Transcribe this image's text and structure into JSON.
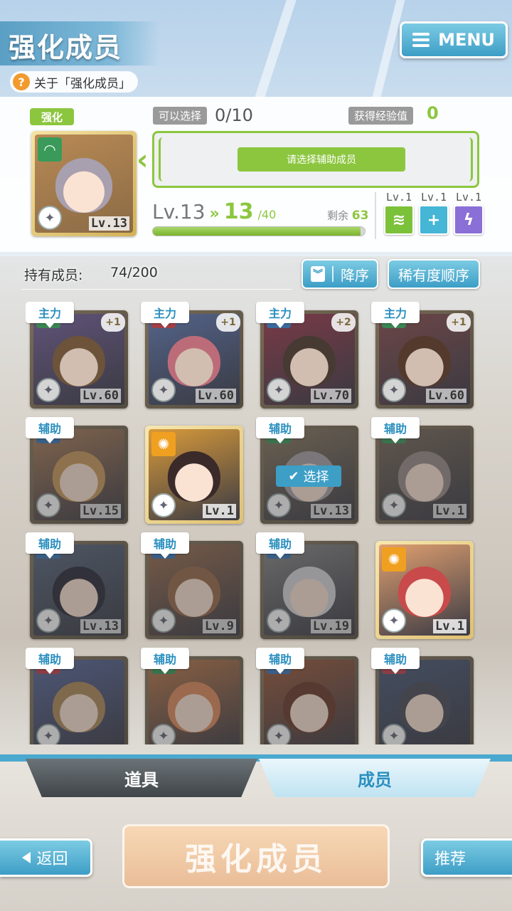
{
  "header": {
    "title": "强化成员",
    "help_text": "关于「强化成员」",
    "help_icon": "?",
    "menu_label": "MENU"
  },
  "enhance": {
    "tag": "强化",
    "selectable_label": "可以选择",
    "selectable_count": "0/10",
    "exp_label": "获得经验值",
    "exp_value": "0",
    "slot_hint": "请选择辅助成员",
    "base_card_level": "Lv.13",
    "level_current": "Lv.13",
    "level_arrows": "»",
    "level_new": "13",
    "level_max": "/40",
    "remain_label": "剩余",
    "remain_value": "63",
    "exp_progress": 0.98,
    "skills": [
      {
        "level": "Lv.1",
        "icon": "wave-skill-icon",
        "color": "#7cc13a"
      },
      {
        "level": "Lv.1",
        "icon": "plus-skill-icon",
        "color": "#45b6d6"
      },
      {
        "level": "Lv.1",
        "icon": "all-skill-icon",
        "color": "#8a6fd6"
      }
    ]
  },
  "members": {
    "owned_label": "持有成员:",
    "owned_count": "74/200",
    "sort_order_label": "降序",
    "sort_rarity_label": "稀有度顺序",
    "select_badge": "选择",
    "cards": [
      {
        "role": "主力",
        "level": "Lv.60",
        "plus": "+1",
        "attr": "#3a9a5a",
        "bg": "#6b5a8a",
        "hair": "#7a5a3a"
      },
      {
        "role": "主力",
        "level": "Lv.60",
        "plus": "+1",
        "attr": "#c0404a",
        "bg": "#5a6fa0",
        "hair": "#e07a8a"
      },
      {
        "role": "主力",
        "level": "Lv.70",
        "plus": "+2",
        "attr": "#3a78b8",
        "bg": "#8a3a4a",
        "hair": "#4a3a30"
      },
      {
        "role": "主力",
        "level": "Lv.60",
        "plus": "+1",
        "attr": "#3a9a5a",
        "bg": "#7a4a4a",
        "hair": "#5a3a2a"
      },
      {
        "role": "辅助",
        "level": "Lv.15",
        "plus": "",
        "attr": "#3a78b8",
        "bg": "#b0805a",
        "hair": "#c89a5a"
      },
      {
        "role": "",
        "level": "Lv.1",
        "plus": "",
        "attr": "#f0a020",
        "bg": "#d89a3a",
        "hair": "#3a2a2a"
      },
      {
        "role": "辅助",
        "level": "Lv.13",
        "plus": "",
        "attr": "#3a9a5a",
        "bg": "#8a7a60",
        "hair": "#a8a0a8",
        "selected": true
      },
      {
        "role": "辅助",
        "level": "Lv.1",
        "plus": "",
        "attr": "#3a9a5a",
        "bg": "#7a6a5a",
        "hair": "#9a8a8a"
      },
      {
        "role": "辅助",
        "level": "Lv.13",
        "plus": "",
        "attr": "#3a78b8",
        "bg": "#5a6a80",
        "hair": "#2a2a3a"
      },
      {
        "role": "辅助",
        "level": "Lv.9",
        "plus": "",
        "attr": "#3a78b8",
        "bg": "#a07050",
        "hair": "#9a6a4a"
      },
      {
        "role": "辅助",
        "level": "Lv.19",
        "plus": "",
        "attr": "#3a78b8",
        "bg": "#8a8a8a",
        "hair": "#d8d8dc"
      },
      {
        "role": "",
        "level": "Lv.1",
        "plus": "",
        "attr": "#f0a020",
        "bg": "#e0a070",
        "hair": "#c84a4a"
      },
      {
        "role": "辅助",
        "level": "",
        "plus": "",
        "attr": "#c0404a",
        "bg": "#5a6aa0",
        "hair": "#b08a5a"
      },
      {
        "role": "辅助",
        "level": "",
        "plus": "",
        "attr": "#3a9a5a",
        "bg": "#c07a4a",
        "hair": "#e08a5a"
      },
      {
        "role": "辅助",
        "level": "",
        "plus": "",
        "attr": "#3a78b8",
        "bg": "#a05a3a",
        "hair": "#6a3a2a"
      },
      {
        "role": "辅助",
        "level": "",
        "plus": "",
        "attr": "#c0404a",
        "bg": "#4a5a7a",
        "hair": "#4a4a5a"
      }
    ]
  },
  "tabs": {
    "items": "道具",
    "members": "成员"
  },
  "footer": {
    "back_label": "返回",
    "enhance_label": "强化成员",
    "recommend_label": "推荐"
  }
}
